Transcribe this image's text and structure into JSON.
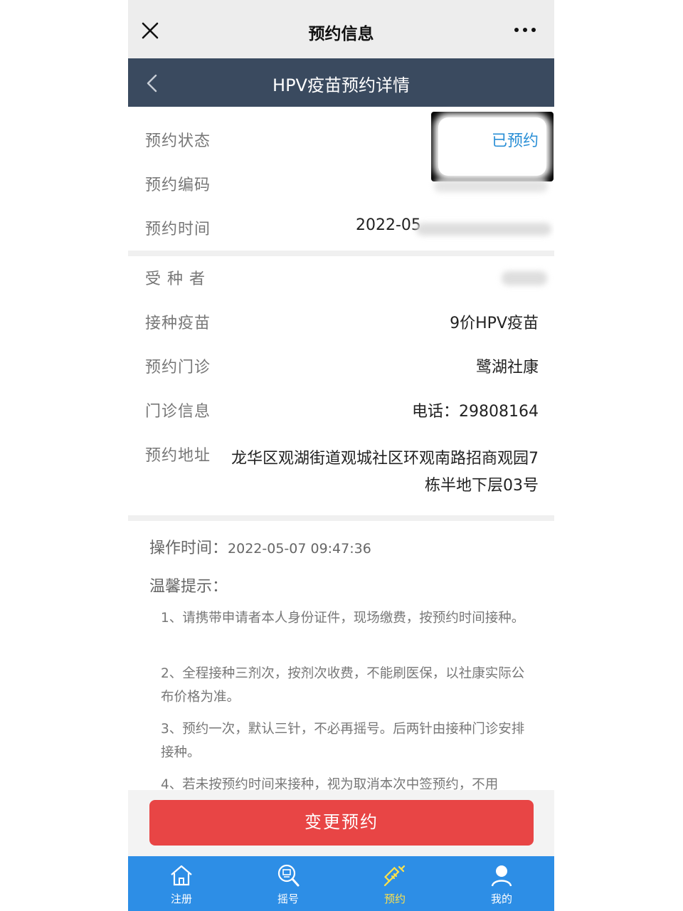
{
  "wechat_bar": {
    "title": "预约信息",
    "close_icon": "close-icon",
    "more_icon": "more-icon"
  },
  "header": {
    "title": "HPV疫苗预约详情",
    "back_icon": "chevron-left-icon"
  },
  "details": {
    "status": {
      "label": "预约状态",
      "value": "已预约"
    },
    "code": {
      "label": "预约编码",
      "value": ""
    },
    "time": {
      "label": "预约时间",
      "value": "2022-05"
    },
    "recipient": {
      "label": "受 种 者",
      "value": ""
    },
    "vaccine": {
      "label": "接种疫苗",
      "value": "9价HPV疫苗"
    },
    "clinic": {
      "label": "预约门诊",
      "value": "鹭湖社康"
    },
    "clinic_info": {
      "label": "门诊信息",
      "value": "电话：29808164"
    },
    "address": {
      "label": "预约地址",
      "value": "龙华区观湖街道观城社区环观南路招商观园7栋半地下层03号"
    }
  },
  "operation": {
    "label": "操作时间：",
    "time": "2022-05-07 09:47:36"
  },
  "tips": {
    "title": "温馨提示：",
    "items": [
      "1、请携带申请者本人身份证件，现场缴费，按预约时间接种。",
      "2、全程接种三剂次，按剂次收费，不能刷医保，以社康实际公布价格为准。",
      "3、预约一次，默认三针，不必再摇号。后两针由接种门诊安排接种。",
      "4、若未按预约时间来接种，视为取消本次中签预约，不用"
    ]
  },
  "change_button": "变更预约",
  "tabbar": {
    "items": [
      {
        "label": "注册",
        "icon": "home-icon"
      },
      {
        "label": "摇号",
        "icon": "search-number-icon"
      },
      {
        "label": "预约",
        "icon": "syringe-icon"
      },
      {
        "label": "我的",
        "icon": "user-icon"
      }
    ],
    "active_index": 2
  },
  "colors": {
    "header_bg": "#3a4a5f",
    "status_blue": "#2a8fd6",
    "button_red": "#e84545",
    "tabbar_blue": "#2d8ee6",
    "tab_active": "#ffe24a"
  }
}
